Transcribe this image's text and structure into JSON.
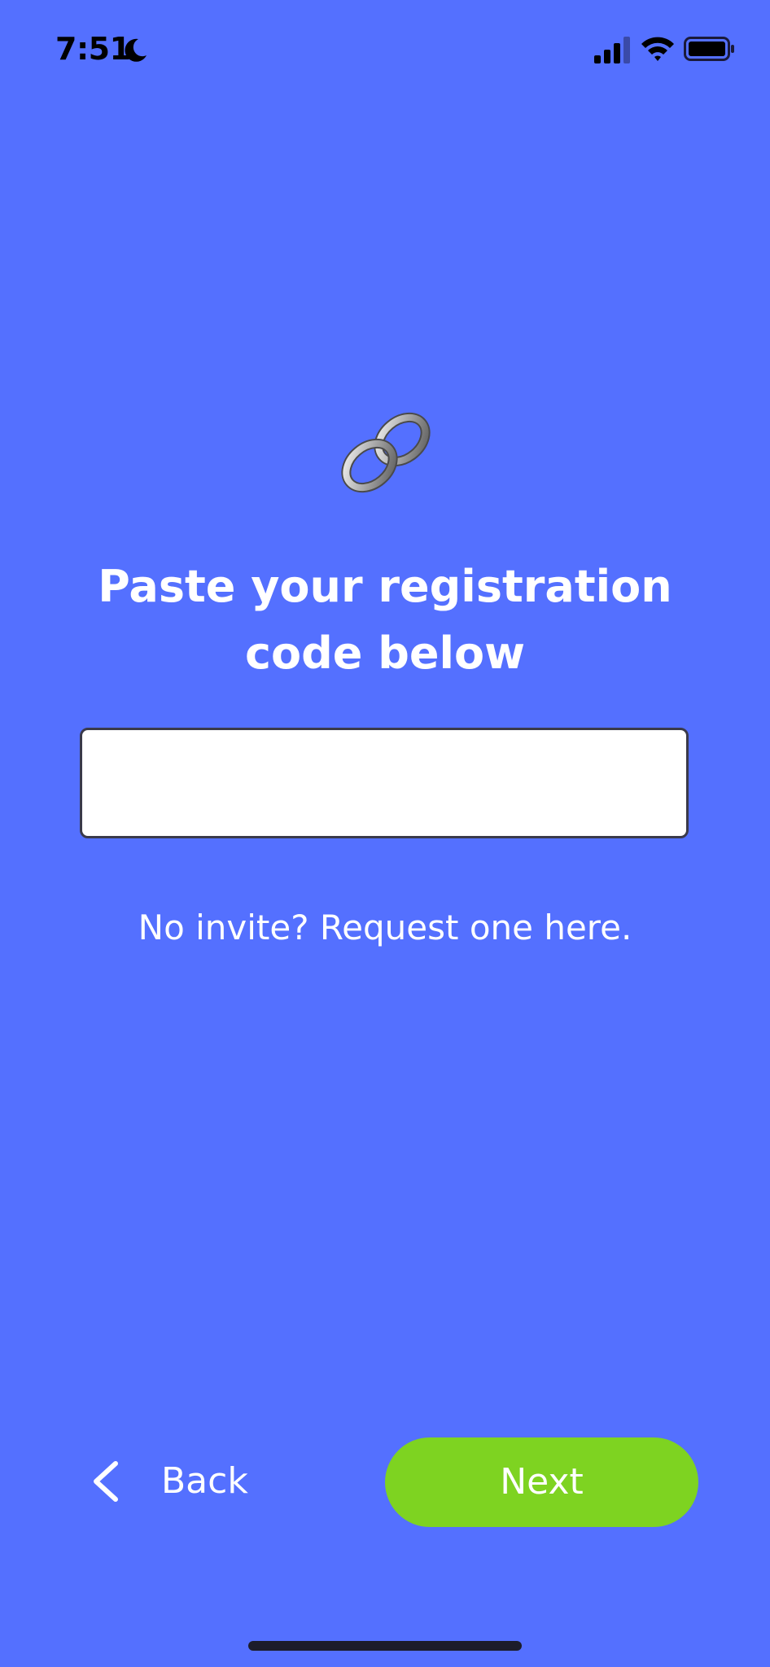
{
  "status_bar": {
    "time": "7:51",
    "icons": [
      "moon-icon",
      "cellular-signal-icon",
      "wifi-icon",
      "battery-icon"
    ]
  },
  "hero": {
    "icon": "link-icon",
    "title": "Paste your registration code below"
  },
  "code_input": {
    "value": "",
    "placeholder": ""
  },
  "request_link": "No invite? Request one here.",
  "nav": {
    "back_label": "Back",
    "next_label": "Next"
  },
  "colors": {
    "background": "#5470FF",
    "next_button": "#7ED321",
    "text": "#FFFFFF"
  }
}
